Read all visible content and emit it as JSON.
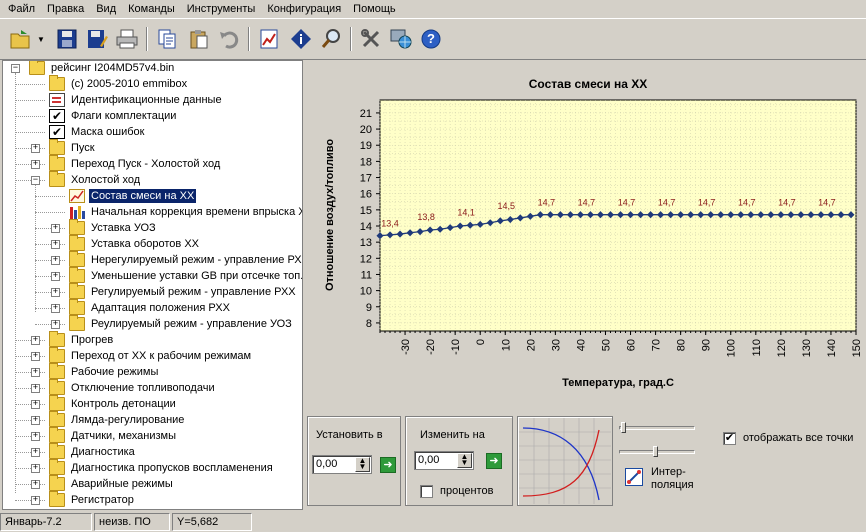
{
  "menu": [
    "Файл",
    "Правка",
    "Вид",
    "Команды",
    "Инструменты",
    "Конфигурация",
    "Помощь"
  ],
  "tree": {
    "root": "рейсинг I204MD57v4.bin",
    "items": [
      {
        "label": "(c) 2005-2010 emmibox",
        "icon": "folder-icon"
      },
      {
        "label": "Идентификационные данные",
        "icon": "document-icon"
      },
      {
        "label": "Флаги комплектации",
        "icon": "checkbox-icon"
      },
      {
        "label": "Маска ошибок",
        "icon": "checkbox-icon"
      },
      {
        "label": "Пуск",
        "icon": "folder-icon"
      },
      {
        "label": "Переход Пуск - Холостой ход",
        "icon": "folder-icon"
      },
      {
        "label": "Холостой ход",
        "icon": "folder-open-icon"
      },
      {
        "label": "Состав смеси на ХХ",
        "icon": "chart-icon"
      },
      {
        "label": "Начальная коррекция времени впрыска Х",
        "icon": "bar-chart-icon"
      },
      {
        "label": "Уставка УОЗ",
        "icon": "folder-icon"
      },
      {
        "label": "Уставка оборотов ХХ",
        "icon": "folder-icon"
      },
      {
        "label": "Нерегулируемый режим - управление РХ",
        "icon": "folder-icon"
      },
      {
        "label": "Уменьшение уставки GB при отсечке топ.",
        "icon": "folder-icon"
      },
      {
        "label": "Регулируемый режим - управление РХХ",
        "icon": "folder-icon"
      },
      {
        "label": "Адаптация положения  РХХ",
        "icon": "folder-icon"
      },
      {
        "label": "Реулируемый режим - управление УОЗ",
        "icon": "folder-icon"
      },
      {
        "label": "Прогрев",
        "icon": "folder-icon"
      },
      {
        "label": "Переход от ХХ к рабочим режимам",
        "icon": "folder-icon"
      },
      {
        "label": "Рабочие режимы",
        "icon": "folder-icon"
      },
      {
        "label": "Отключение топливоподачи",
        "icon": "folder-icon"
      },
      {
        "label": "Контроль детонации",
        "icon": "folder-icon"
      },
      {
        "label": "Лямда-регулирование",
        "icon": "folder-icon"
      },
      {
        "label": "Датчики, механизмы",
        "icon": "folder-icon"
      },
      {
        "label": "Диагностика",
        "icon": "folder-icon"
      },
      {
        "label": "Диагностика пропусков воспламенения",
        "icon": "folder-icon"
      },
      {
        "label": "Аварийные режимы",
        "icon": "folder-icon"
      },
      {
        "label": "Регистратор",
        "icon": "folder-icon"
      }
    ]
  },
  "chart_data": {
    "type": "line",
    "title": "Состав смеси на ХХ",
    "xlabel": "Температура, град.С",
    "ylabel": "Отношение воздух/топливо",
    "xlim": [
      -40,
      150
    ],
    "ylim": [
      7.5,
      21.8
    ],
    "xticks": [
      -30,
      -20,
      -10,
      0,
      10,
      20,
      30,
      40,
      50,
      60,
      70,
      80,
      90,
      100,
      110,
      120,
      130,
      140,
      150
    ],
    "yticks": [
      8,
      9,
      10,
      11,
      12,
      13,
      14,
      15,
      16,
      17,
      18,
      19,
      20,
      21
    ],
    "grid": true,
    "legend": "none",
    "color": "#1f3a7a",
    "label_color": "#8b1a1a",
    "x": [
      -40,
      -36,
      -32,
      -28,
      -24,
      -20,
      -16,
      -12,
      -8,
      -4,
      0,
      4,
      8,
      12,
      16,
      20,
      24,
      28,
      32,
      36,
      40,
      44,
      48,
      52,
      56,
      60,
      64,
      68,
      72,
      76,
      80,
      84,
      88,
      92,
      96,
      100,
      104,
      108,
      112,
      116,
      120,
      124,
      128,
      132,
      136,
      140,
      144,
      148
    ],
    "y": [
      13.4,
      13.45,
      13.5,
      13.58,
      13.65,
      13.75,
      13.8,
      13.9,
      14.0,
      14.05,
      14.1,
      14.2,
      14.32,
      14.4,
      14.5,
      14.6,
      14.7,
      14.7,
      14.7,
      14.7,
      14.7,
      14.7,
      14.7,
      14.7,
      14.7,
      14.7,
      14.7,
      14.7,
      14.7,
      14.7,
      14.7,
      14.7,
      14.7,
      14.7,
      14.7,
      14.7,
      14.7,
      14.7,
      14.7,
      14.7,
      14.7,
      14.7,
      14.7,
      14.7,
      14.7,
      14.7,
      14.7,
      14.7
    ],
    "data_labels": [
      {
        "x": -40,
        "y": 13.4,
        "text": "13,4"
      },
      {
        "x": -24,
        "y": 13.8,
        "text": "13,8"
      },
      {
        "x": -8,
        "y": 14.1,
        "text": "14,1"
      },
      {
        "x": 8,
        "y": 14.5,
        "text": "14,5"
      },
      {
        "x": 24,
        "y": 14.7,
        "text": "14,7"
      },
      {
        "x": 40,
        "y": 14.7,
        "text": "14,7"
      },
      {
        "x": 56,
        "y": 14.7,
        "text": "14,7"
      },
      {
        "x": 72,
        "y": 14.7,
        "text": "14,7"
      },
      {
        "x": 88,
        "y": 14.7,
        "text": "14,7"
      },
      {
        "x": 104,
        "y": 14.7,
        "text": "14,7"
      },
      {
        "x": 120,
        "y": 14.7,
        "text": "14,7"
      },
      {
        "x": 136,
        "y": 14.7,
        "text": "14,7"
      }
    ]
  },
  "controls": {
    "set_to_label": "Установить в",
    "set_to_value": "0,00",
    "change_by_label": "Изменить на",
    "change_by_value": "0,00",
    "percent_label": "процентов",
    "percent_checked": false,
    "interp_label": "Интер-\nполяция",
    "show_all_label": "отображать все точки",
    "show_all_checked": true
  },
  "status": {
    "month": "Январь-7.2",
    "mod": "неизв. ПО",
    "coord": "Y=5,682"
  }
}
